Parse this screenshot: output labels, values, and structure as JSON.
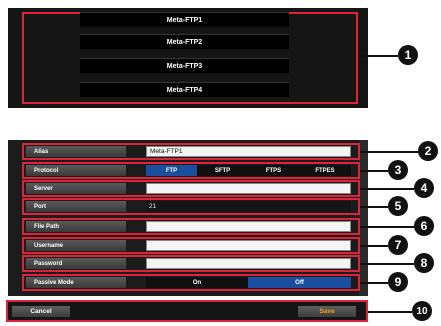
{
  "ftp_list": [
    "Meta-FTP1",
    "Meta-FTP2",
    "Meta-FTP3",
    "Meta-FTP4"
  ],
  "settings": {
    "alias": {
      "label": "Alias",
      "value": "Meta-FTP1"
    },
    "protocol": {
      "label": "Protocol",
      "options": [
        "FTP",
        "SFTP",
        "FTPS",
        "FTPES"
      ],
      "selected": "FTP"
    },
    "server": {
      "label": "Server",
      "value": ""
    },
    "port": {
      "label": "Port",
      "value": "21"
    },
    "file_path": {
      "label": "File Path",
      "value": ""
    },
    "username": {
      "label": "Username",
      "value": ""
    },
    "password": {
      "label": "Password",
      "value": ""
    },
    "passive_mode": {
      "label": "Passive Mode",
      "options": [
        "On",
        "Off"
      ],
      "selected": "Off"
    }
  },
  "footer": {
    "cancel_label": "Cancel",
    "save_label": "Save"
  },
  "callouts": [
    "1",
    "2",
    "3",
    "4",
    "5",
    "6",
    "7",
    "8",
    "9",
    "10"
  ],
  "colors": {
    "highlight_frame": "#e0223a",
    "selected_segment": "#1a4fa0",
    "save_text": "#e8a21a"
  }
}
